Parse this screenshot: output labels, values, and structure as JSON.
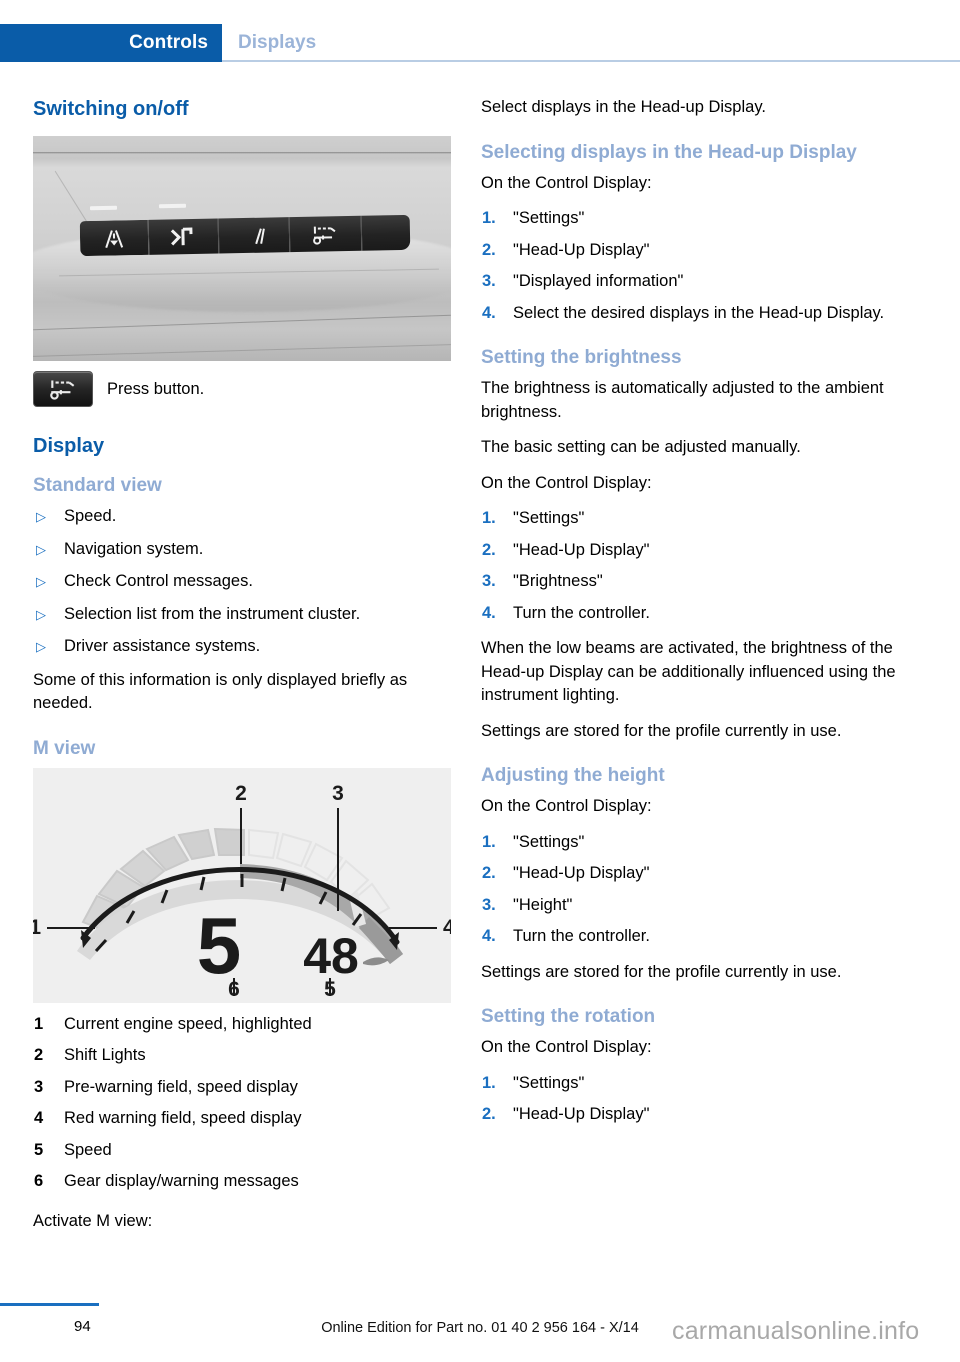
{
  "header": {
    "active_tab": "Controls",
    "inactive_tab": "Displays",
    "accent_active_bg": "#0a5ca8",
    "accent_inactive_text": "#9bb4d8"
  },
  "left_column": {
    "heading": "Switching on/off",
    "photo_alt": "Driver side button panel with four driver-assistance buttons",
    "press_label": "Press button.",
    "display_heading": "Display",
    "standard_view": {
      "heading": "Standard view",
      "bullet_glyph": "▷",
      "items": [
        "Speed.",
        "Navigation system.",
        "Check Control messages.",
        "Selection list from the instrument cluster.",
        "Driver assistance systems."
      ],
      "note": "Some of this information is only displayed briefly as needed."
    },
    "m_view": {
      "heading": "M view",
      "legend": [
        {
          "num": "1",
          "label": "Current engine speed, highlighted"
        },
        {
          "num": "2",
          "label": "Shift Lights"
        },
        {
          "num": "3",
          "label": "Pre-warning field, speed display"
        },
        {
          "num": "4",
          "label": "Red warning field, speed display"
        },
        {
          "num": "5",
          "label": "Speed"
        },
        {
          "num": "6",
          "label": "Gear display/warning messages"
        }
      ],
      "activate_text": "Activate M view:",
      "gauge_labels": {
        "callout_1": "1",
        "callout_2": "2",
        "callout_3": "3",
        "callout_4": "4",
        "callout_5": "5",
        "callout_6": "6",
        "gear": "5",
        "speed": "48"
      }
    }
  },
  "right_column": {
    "intro": "Select displays in the Head-up Display.",
    "sections": [
      {
        "heading": "Selecting displays in the Head-up Display",
        "lead": "On the Control Display:",
        "steps": [
          "\"Settings\"",
          "\"Head-Up Display\"",
          "\"Displayed information\"",
          "Select the desired displays in the Head-up Display."
        ],
        "after": []
      },
      {
        "heading": "Setting the brightness",
        "lead": "On the Control Display:",
        "pre": [
          "The brightness is automatically adjusted to the ambient brightness.",
          "The basic setting can be adjusted manually."
        ],
        "steps": [
          "\"Settings\"",
          "\"Head-Up Display\"",
          "\"Brightness\"",
          "Turn the controller."
        ],
        "after": [
          "When the low beams are activated, the brightness of the Head-up Display can be additionally influenced using the instrument lighting.",
          "Settings are stored for the profile currently in use."
        ]
      },
      {
        "heading": "Adjusting the height",
        "lead": "On the Control Display:",
        "steps": [
          "\"Settings\"",
          "\"Head-Up Display\"",
          "\"Height\"",
          "Turn the controller."
        ],
        "after": [
          "Settings are stored for the profile currently in use."
        ]
      },
      {
        "heading": "Setting the rotation",
        "lead": "On the Control Display:",
        "steps": [
          "\"Settings\"",
          "\"Head-Up Display\""
        ],
        "after": []
      }
    ]
  },
  "footer": {
    "page_number": "94",
    "edition_note": "Online Edition for Part no. 01 40 2 956 164 - X/14",
    "watermark": "carmanualsonline.info",
    "rule_color": "#1a6fc0"
  }
}
